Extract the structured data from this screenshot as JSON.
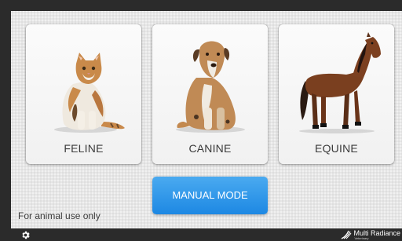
{
  "cards": [
    {
      "id": "feline",
      "label": "FELINE",
      "icon": "cat-image"
    },
    {
      "id": "canine",
      "label": "CANINE",
      "icon": "dog-image"
    },
    {
      "id": "equine",
      "label": "EQUINE",
      "icon": "horse-image"
    }
  ],
  "manual_button": {
    "label": "MANUAL MODE",
    "color": "#2a93e8"
  },
  "footer_note": "For animal use only",
  "bottom_bar": {
    "settings_icon": "gear-icon",
    "brand_name": "Multi Radiance",
    "brand_sub": "Veterinary"
  }
}
